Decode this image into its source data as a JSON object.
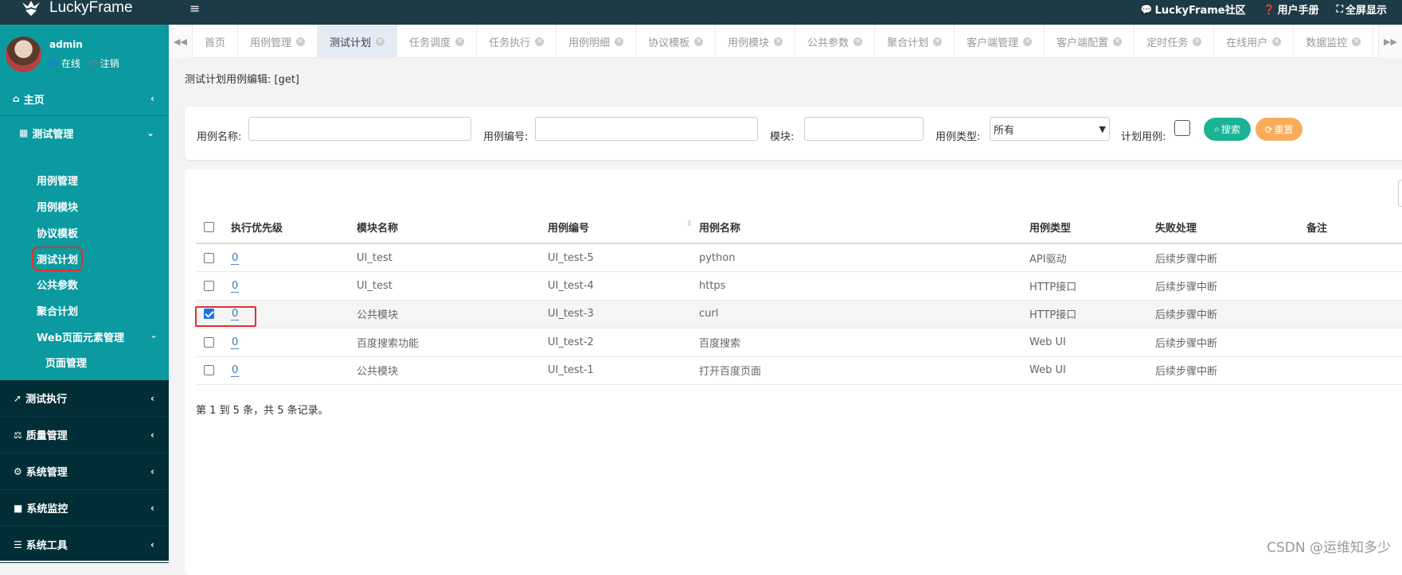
{
  "app": {
    "logo_text": "LuckyFrame",
    "top_links": [
      {
        "icon": "comments-icon",
        "glyph": "💬",
        "label": "LuckyFrame社区"
      },
      {
        "icon": "question-circle-icon",
        "glyph": "❓",
        "label": "用户手册"
      },
      {
        "icon": "fullscreen-icon",
        "glyph": "⛶",
        "label": "全屏显示"
      }
    ]
  },
  "user": {
    "name": "admin",
    "status": "在线",
    "logout": "注销"
  },
  "sidebar": {
    "home": "主页",
    "test_mgmt": {
      "label": "测试管理",
      "items": [
        "用例管理",
        "用例模块",
        "协议模板",
        "测试计划",
        "公共参数",
        "聚合计划",
        "Web页面元素管理",
        "页面管理"
      ]
    },
    "groups": [
      "测试执行",
      "质量管理",
      "系统管理",
      "系统监控",
      "系统工具"
    ]
  },
  "tabs": [
    "首页",
    "用例管理",
    "测试计划",
    "任务调度",
    "任务执行",
    "用例明细",
    "协议模板",
    "用例模块",
    "公共参数",
    "聚合计划",
    "客户端管理",
    "客户端配置",
    "定时任务",
    "在线用户",
    "数据监控"
  ],
  "active_tab": "测试计划",
  "breadcrumb": "测试计划用例编辑: [get]",
  "search": {
    "case_name_label": "用例名称:",
    "case_no_label": "用例编号:",
    "module_label": "模块:",
    "case_type_label": "用例类型:",
    "case_type_value": "所有",
    "plan_case_label": "计划用例:",
    "search_btn": "搜索",
    "reset_btn": "重置"
  },
  "table": {
    "headers": [
      "执行优先级",
      "模块名称",
      "用例编号",
      "用例名称",
      "用例类型",
      "失败处理",
      "备注"
    ],
    "rows": [
      {
        "checked": false,
        "priority": "0",
        "module": "UI_test",
        "case_no": "UI_test-5",
        "case_name": "python",
        "type": "API驱动",
        "fail": "后续步骤中断",
        "note": ""
      },
      {
        "checked": false,
        "priority": "0",
        "module": "UI_test",
        "case_no": "UI_test-4",
        "case_name": "https",
        "type": "HTTP接口",
        "fail": "后续步骤中断",
        "note": ""
      },
      {
        "checked": true,
        "priority": "0",
        "module": "公共模块",
        "case_no": "UI_test-3",
        "case_name": "curl",
        "type": "HTTP接口",
        "fail": "后续步骤中断",
        "note": ""
      },
      {
        "checked": false,
        "priority": "0",
        "module": "百度搜索功能",
        "case_no": "UI_test-2",
        "case_name": "百度搜索",
        "type": "Web UI",
        "fail": "后续步骤中断",
        "note": ""
      },
      {
        "checked": false,
        "priority": "0",
        "module": "公共模块",
        "case_no": "UI_test-1",
        "case_name": "打开百度页面",
        "type": "Web UI",
        "fail": "后续步骤中断",
        "note": ""
      }
    ],
    "pagination": "第 1 到 5 条，共 5 条记录。"
  },
  "watermark": "CSDN @运维知多少"
}
